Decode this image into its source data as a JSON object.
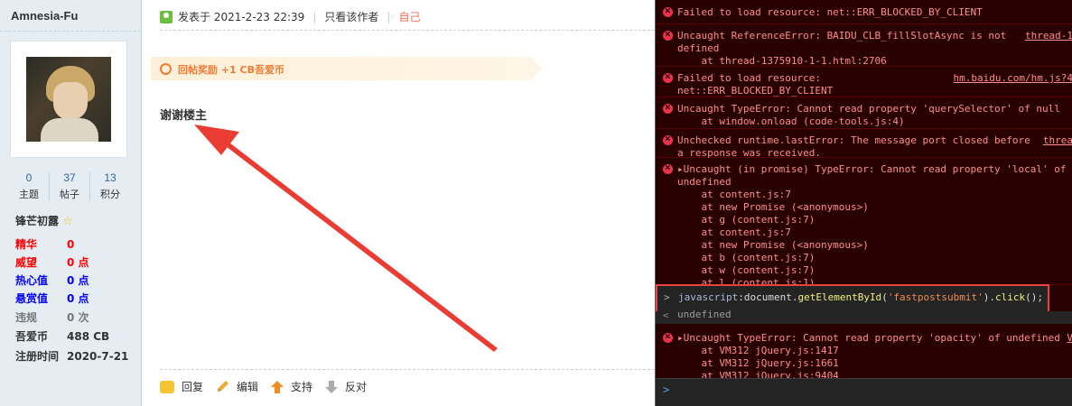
{
  "user": {
    "name": "Amnesia-Fu",
    "stats": [
      {
        "value": "0",
        "label": "主题"
      },
      {
        "value": "37",
        "label": "帖子"
      },
      {
        "value": "13",
        "label": "积分"
      }
    ],
    "rank": "锋芒初露",
    "attributes": [
      {
        "key": "精华",
        "value": "0",
        "color": "#ff0000"
      },
      {
        "key": "威望",
        "value": "0 点",
        "color": "#ff0000"
      },
      {
        "key": "热心值",
        "value": "0 点",
        "color": "#0000ff"
      },
      {
        "key": "悬赏值",
        "value": "0 点",
        "color": "#0000ff"
      },
      {
        "key": "违规",
        "value": "0 次",
        "color": "#777777"
      },
      {
        "key": "吾爱币",
        "value": "488 CB",
        "color": "#333333"
      },
      {
        "key": "注册时间",
        "value": "2020-7-21",
        "color": "#333333"
      }
    ]
  },
  "post": {
    "posted_label": "发表于 2021-2-23 22:39",
    "only_author": "只看该作者",
    "self": "自己",
    "reward": "回帖奖励 +1 CB吾爱币",
    "content": "谢谢楼主",
    "actions": {
      "reply": "回复",
      "edit": "编辑",
      "support": "支持",
      "oppose": "反对"
    }
  },
  "console": {
    "messages": [
      {
        "lines": [
          "Failed to load resource: net::ERR_BLOCKED_BY_CLIENT"
        ],
        "source": ""
      },
      {
        "lines": [
          "Uncaught ReferenceError: BAIDU_CLB_fillSlotAsync is not",
          "defined",
          "    at thread-1375910-1-1.html:2706"
        ],
        "source": "thread-1"
      },
      {
        "lines": [
          "Failed to load resource:",
          "net::ERR_BLOCKED_BY_CLIENT"
        ],
        "source": "hm.baidu.com/hm.js?4"
      },
      {
        "lines": [
          "Uncaught TypeError: Cannot read property 'querySelector' of null",
          "    at window.onload (code-tools.js:4)"
        ],
        "source": ""
      },
      {
        "lines": [
          "Unchecked runtime.lastError: The message port closed before",
          "a response was received."
        ],
        "source": "threa"
      },
      {
        "lines": [
          "▸Uncaught (in promise) TypeError: Cannot read property 'local' of",
          "undefined",
          "    at content.js:7",
          "    at new Promise (<anonymous>)",
          "    at g (content.js:7)",
          "    at content.js:7",
          "    at new Promise (<anonymous>)",
          "    at b (content.js:7)",
          "    at w (content.js:7)",
          "    at l (content.js:1)"
        ],
        "source": ""
      },
      {
        "lines": [
          "▸Uncaught TypeError: Cannot read property 'opacity' of undefined",
          "    at VM312 jQuery.js:1417",
          "    at VM312 jQuery.js:1661",
          "    at VM312 jQuery.js:9404"
        ],
        "source": "V"
      }
    ],
    "input": {
      "prefix": "javascript",
      "sep": ":",
      "obj": "document",
      "dot1": ".",
      "method": "getElementById",
      "open": "(",
      "arg": "'fastpostsubmit'",
      "close": ").",
      "method2": "click",
      "end": "();"
    },
    "result": "undefined",
    "prompt_symbol": ">",
    "result_symbol": "<"
  }
}
